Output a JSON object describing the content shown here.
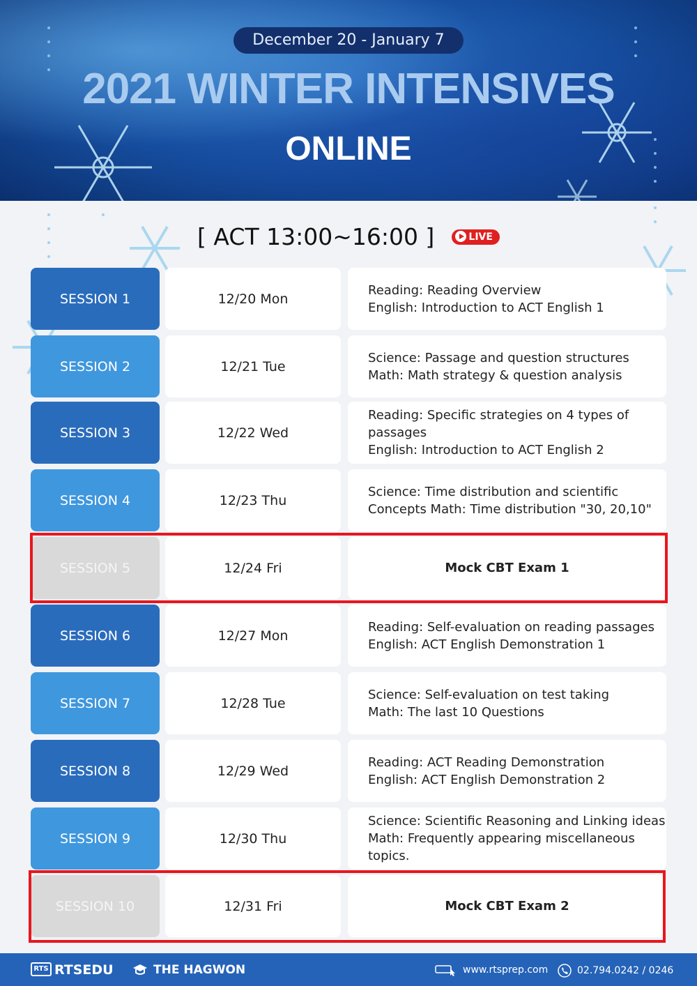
{
  "header": {
    "date_range": "December 20 - January 7",
    "title": "2021 WINTER INTENSIVES",
    "subtitle": "ONLINE"
  },
  "section": {
    "heading": "[ ACT 13:00~16:00 ]",
    "live_label": "LIVE"
  },
  "sessions": [
    {
      "label": "SESSION 1",
      "date": "12/20 Mon",
      "line1": "Reading: Reading Overview",
      "line2": "English: Introduction to ACT English 1",
      "line3": ""
    },
    {
      "label": "SESSION 2",
      "date": "12/21 Tue",
      "line1": "Science: Passage and question structures",
      "line2": "Math: Math strategy & question analysis",
      "line3": ""
    },
    {
      "label": "SESSION 3",
      "date": "12/22 Wed",
      "line1": "Reading: Specific strategies on 4 types of",
      "line2": "passages",
      "line3": "English: Introduction to ACT English 2"
    },
    {
      "label": "SESSION 4",
      "date": "12/23 Thu",
      "line1": "Science: Time distribution and scientific",
      "line2": "Concepts Math: Time distribution \"30, 20,10\"",
      "line3": ""
    },
    {
      "label": "SESSION 5",
      "date": "12/24 Fri",
      "line1": "Mock CBT Exam 1",
      "line2": "",
      "line3": ""
    },
    {
      "label": "SESSION 6",
      "date": "12/27 Mon",
      "line1": "Reading: Self-evaluation on reading passages",
      "line2": "English: ACT English Demonstration 1",
      "line3": ""
    },
    {
      "label": "SESSION 7",
      "date": "12/28 Tue",
      "line1": "Science: Self-evaluation on test taking",
      "line2": "Math: The last 10 Questions",
      "line3": ""
    },
    {
      "label": "SESSION 8",
      "date": "12/29 Wed",
      "line1": "Reading: ACT Reading Demonstration",
      "line2": "English: ACT English Demonstration 2",
      "line3": ""
    },
    {
      "label": "SESSION 9",
      "date": "12/30 Thu",
      "line1": "Science: Scientific Reasoning and Linking ideas",
      "line2": "Math: Frequently appearing miscellaneous",
      "line3": "topics."
    },
    {
      "label": "SESSION 10",
      "date": "12/31 Fri",
      "line1": "Mock CBT Exam 2",
      "line2": "",
      "line3": ""
    }
  ],
  "footer": {
    "logo_mark": "RTS",
    "brand1": "RTSEDU",
    "brand2": "THE HAGWON",
    "website": "www.rtsprep.com",
    "phone": "02.794.0242 / 0246"
  },
  "colors": {
    "session_dark": "#2a6cbc",
    "session_light": "#3f97de",
    "session_exam": "#d9d9d9",
    "highlight": "#e8161e",
    "footer": "#2563b8"
  }
}
